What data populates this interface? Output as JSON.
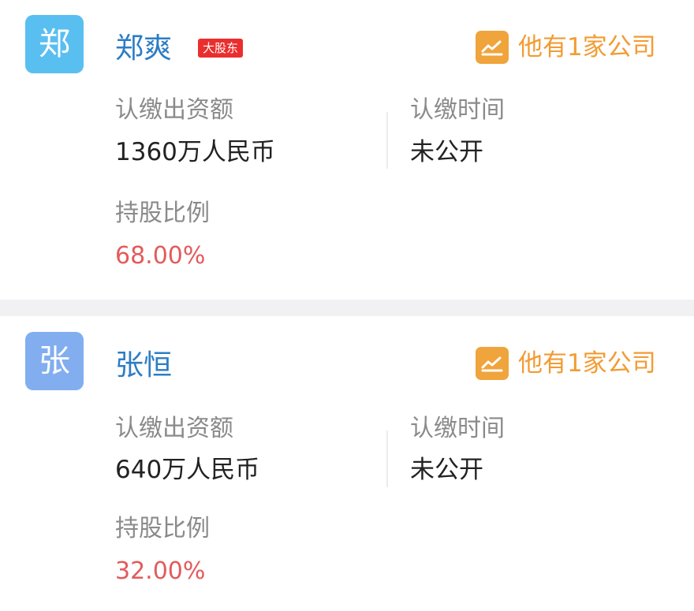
{
  "shareholders": [
    {
      "avatar_text": "郑",
      "avatar_color": "#59bff0",
      "name": "郑爽",
      "badge": "大股东",
      "company_link": "他有1家公司",
      "amount_label": "认缴出资额",
      "amount_value": "1360万人民币",
      "time_label": "认缴时间",
      "time_value": "未公开",
      "ratio_label": "持股比例",
      "ratio_value": "68.00%"
    },
    {
      "avatar_text": "张",
      "avatar_color": "#82aef0",
      "name": "张恒",
      "company_link": "他有1家公司",
      "amount_label": "认缴出资额",
      "amount_value": "640万人民币",
      "time_label": "认缴时间",
      "time_value": "未公开",
      "ratio_label": "持股比例",
      "ratio_value": "32.00%"
    }
  ],
  "colors": {
    "name_blue": "#2c7dc4",
    "badge_red": "#ea2e2e",
    "link_orange": "#f29b33",
    "ratio_red": "#e25b5b"
  },
  "icons": {
    "company": "trend-chart-icon"
  }
}
